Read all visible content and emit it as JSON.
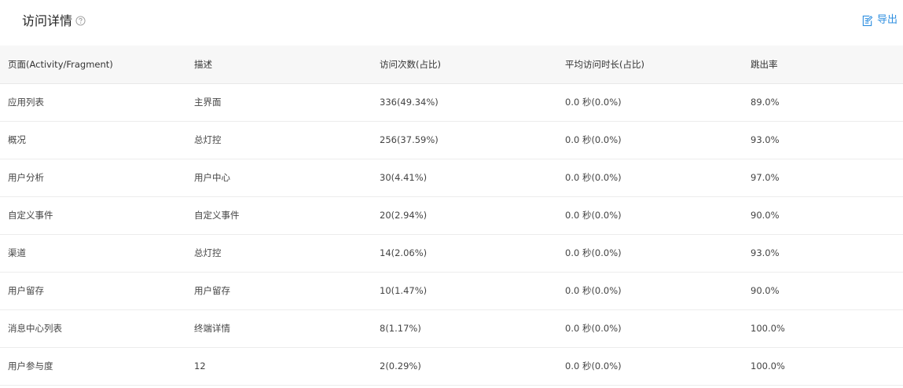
{
  "header": {
    "title": "访问详情",
    "help_icon": "question-circle-icon",
    "export_label": "导出",
    "export_icon": "export-edit-icon",
    "accent_color": "#2f8fe0"
  },
  "table": {
    "columns": [
      "页面(Activity/Fragment)",
      "描述",
      "访问次数(占比)",
      "平均访问时长(占比)",
      "跳出率"
    ],
    "rows": [
      [
        "应用列表",
        "主界面",
        "336(49.34%)",
        "0.0 秒(0.0%)",
        "89.0%"
      ],
      [
        "概况",
        "总灯控",
        "256(37.59%)",
        "0.0 秒(0.0%)",
        "93.0%"
      ],
      [
        "用户分析",
        "用户中心",
        "30(4.41%)",
        "0.0 秒(0.0%)",
        "97.0%"
      ],
      [
        "自定义事件",
        "自定义事件",
        "20(2.94%)",
        "0.0 秒(0.0%)",
        "90.0%"
      ],
      [
        "渠道",
        "总灯控",
        "14(2.06%)",
        "0.0 秒(0.0%)",
        "93.0%"
      ],
      [
        "用户留存",
        "用户留存",
        "10(1.47%)",
        "0.0 秒(0.0%)",
        "90.0%"
      ],
      [
        "消息中心列表",
        "终端详情",
        "8(1.17%)",
        "0.0 秒(0.0%)",
        "100.0%"
      ],
      [
        "用户参与度",
        "12",
        "2(0.29%)",
        "0.0 秒(0.0%)",
        "100.0%"
      ]
    ]
  }
}
